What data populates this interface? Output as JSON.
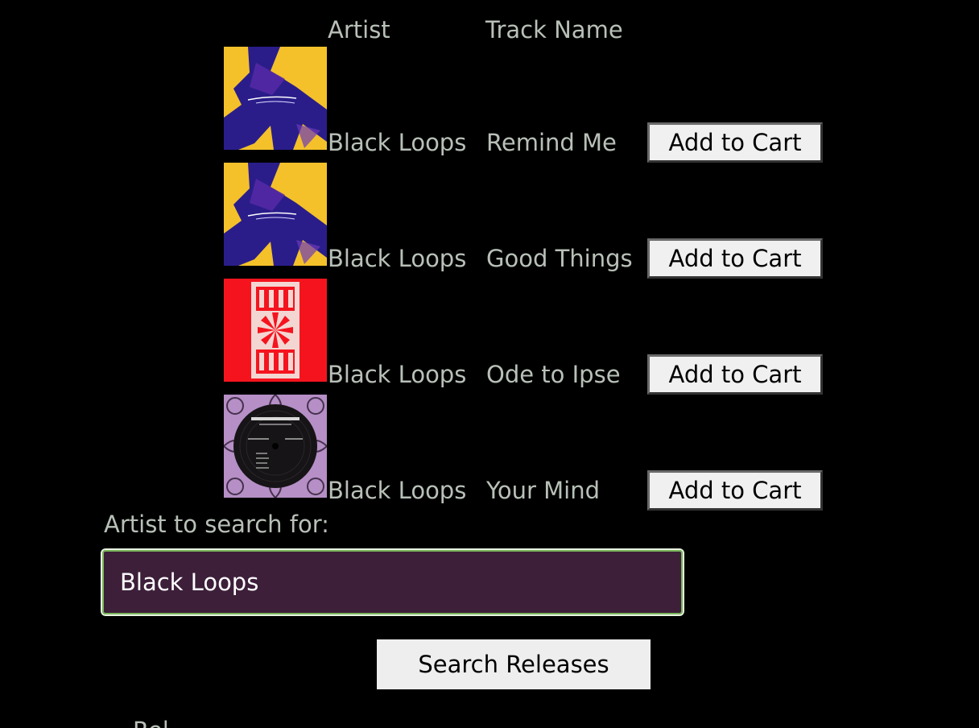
{
  "table": {
    "headers": [
      "Artist",
      "Track Name"
    ],
    "rows": [
      {
        "artist": "Black Loops",
        "track": "Remind Me",
        "action": "Add to Cart",
        "cover": "purple-brush-on-yellow"
      },
      {
        "artist": "Black Loops",
        "track": "Good Things",
        "action": "Add to Cart",
        "cover": "purple-brush-on-yellow"
      },
      {
        "artist": "Black Loops",
        "track": "Ode to Ipse",
        "action": "Add to Cart",
        "cover": "save-ipse-red"
      },
      {
        "artist": "Black Loops",
        "track": "Your Mind",
        "action": "Add to Cart",
        "cover": "black-vinyl-lilac-frame"
      }
    ]
  },
  "search": {
    "label": "Artist to search for:",
    "value": "Black Loops",
    "button_label": "Search Releases"
  },
  "bottom": {
    "heading_fragment": "Rel"
  },
  "colors": {
    "background": "#000000",
    "text": "#b8c0b8",
    "input_bg": "#3d1f3a",
    "input_focus": "#7ab55c",
    "button_bg": "#f0f0f0"
  }
}
